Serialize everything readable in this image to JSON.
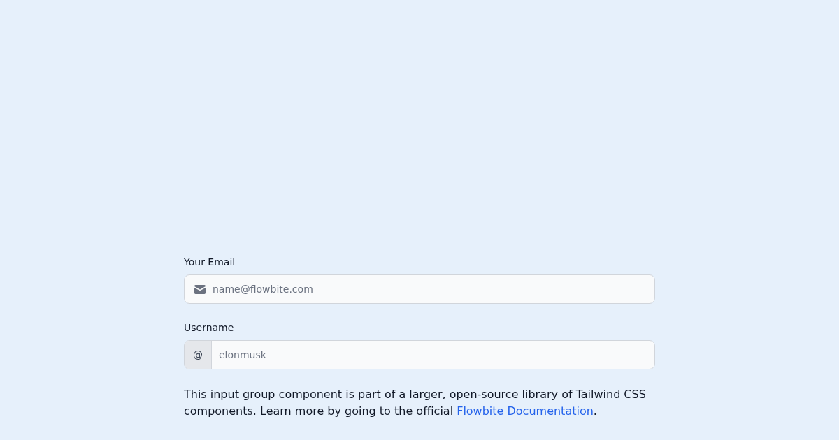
{
  "fields": [
    {
      "kind": "icon",
      "label": "Your Email",
      "placeholder": "name@flowbite.com"
    },
    {
      "kind": "addon",
      "label": "Username",
      "addon": "@",
      "placeholder": "elonmusk"
    }
  ],
  "note": {
    "text_before": "This input group component is part of a larger, open-source library of Tailwind CSS components. Learn more by going to the official ",
    "link": "Flowbite Documentation",
    "text_after": "."
  }
}
